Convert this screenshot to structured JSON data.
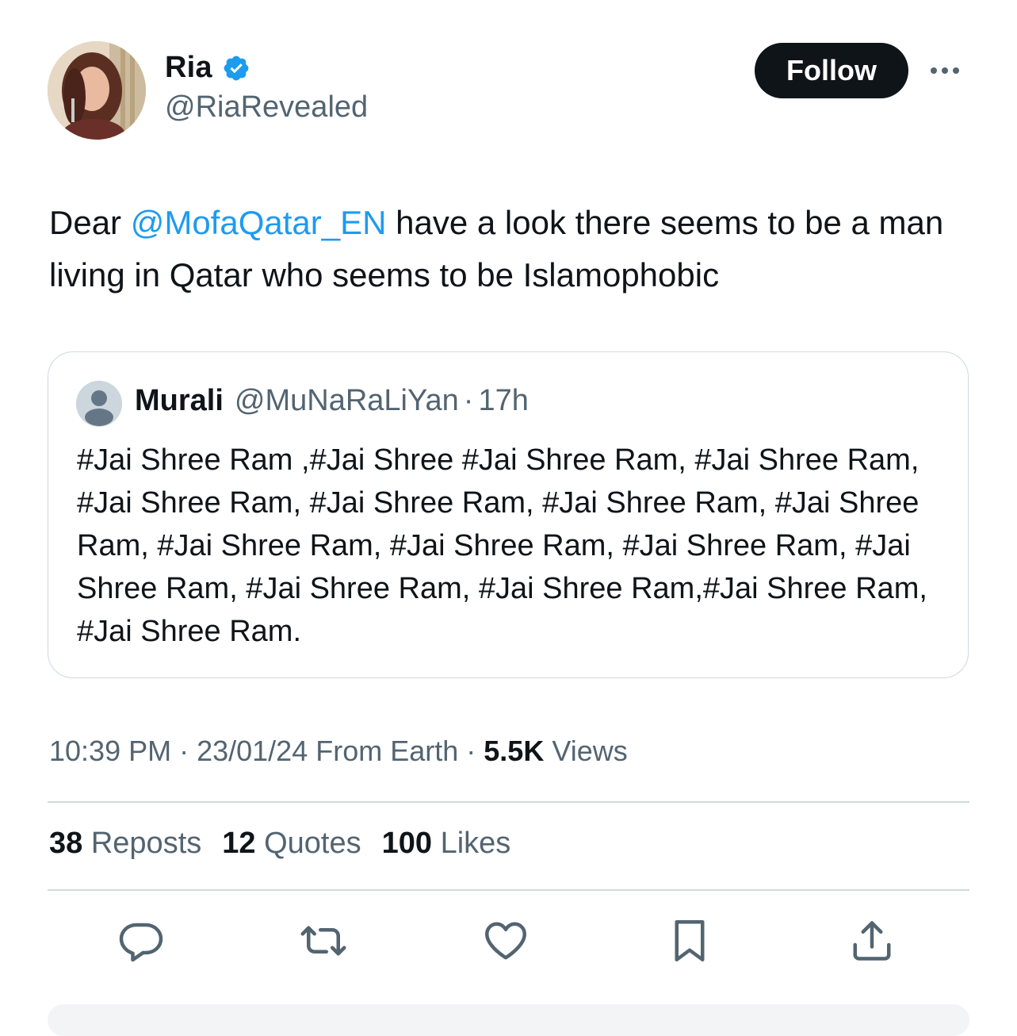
{
  "author": {
    "display_name": "Ria",
    "handle": "@RiaRevealed",
    "verified": true,
    "avatar_icon": "profile-photo"
  },
  "follow_label": "Follow",
  "tweet": {
    "prefix": "Dear ",
    "mention": "@MofaQatar_EN",
    "suffix": " have a look there seems to be a man living in Qatar who seems to be Islamophobic"
  },
  "quoted": {
    "name": "Murali",
    "handle": "@MuNaRaLiYan",
    "separator": "·",
    "time": "17h",
    "text": "#Jai Shree Ram ,#Jai Shree #Jai Shree Ram, #Jai Shree Ram, #Jai Shree Ram, #Jai Shree Ram, #Jai Shree Ram, #Jai Shree Ram, #Jai Shree Ram, #Jai Shree Ram, #Jai Shree Ram, #Jai Shree Ram, #Jai Shree Ram, #Jai Shree Ram,#Jai Shree Ram,  #Jai Shree Ram."
  },
  "meta": {
    "time": "10:39 PM",
    "sep1": " · ",
    "date": "23/01/24",
    "source": " From Earth",
    "sep2": " · ",
    "views_count": "5.5K",
    "views_label": " Views"
  },
  "stats": {
    "reposts_count": "38",
    "reposts_label": "Reposts",
    "quotes_count": "12",
    "quotes_label": "Quotes",
    "likes_count": "100",
    "likes_label": "Likes"
  },
  "actions": [
    "reply-icon",
    "repost-icon",
    "like-icon",
    "bookmark-icon",
    "share-icon"
  ],
  "colors": {
    "text": "#0f1419",
    "secondary": "#536471",
    "link": "#1d9bf0",
    "border": "#cfd9de",
    "verified": "#1d9bf0"
  }
}
